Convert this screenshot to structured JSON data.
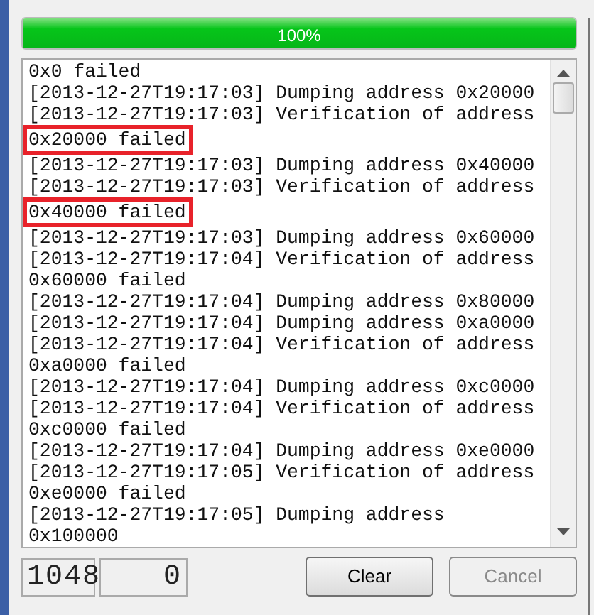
{
  "progress": {
    "level": 1,
    "label": "100%"
  },
  "log": [
    {
      "text": "0x0 failed",
      "highlighted": false
    },
    {
      "text": "[2013-12-27T19:17:03] Dumping address 0x20000",
      "highlighted": false
    },
    {
      "text": "[2013-12-27T19:17:03] Verification of address",
      "highlighted": false
    },
    {
      "text": "0x20000 failed",
      "highlighted": true
    },
    {
      "text": "[2013-12-27T19:17:03] Dumping address 0x40000",
      "highlighted": false
    },
    {
      "text": "[2013-12-27T19:17:03] Verification of address",
      "highlighted": false
    },
    {
      "text": "0x40000 failed",
      "highlighted": true
    },
    {
      "text": "[2013-12-27T19:17:03] Dumping address 0x60000",
      "highlighted": false
    },
    {
      "text": "[2013-12-27T19:17:04] Verification of address",
      "highlighted": false
    },
    {
      "text": "0x60000 failed",
      "highlighted": false
    },
    {
      "text": "[2013-12-27T19:17:04] Dumping address 0x80000",
      "highlighted": false
    },
    {
      "text": "[2013-12-27T19:17:04] Dumping address 0xa0000",
      "highlighted": false
    },
    {
      "text": "[2013-12-27T19:17:04] Verification of address",
      "highlighted": false
    },
    {
      "text": "0xa0000 failed",
      "highlighted": false
    },
    {
      "text": "[2013-12-27T19:17:04] Dumping address 0xc0000",
      "highlighted": false
    },
    {
      "text": "[2013-12-27T19:17:04] Verification of address",
      "highlighted": false
    },
    {
      "text": "0xc0000 failed",
      "highlighted": false
    },
    {
      "text": "[2013-12-27T19:17:04] Dumping address 0xe0000",
      "highlighted": false
    },
    {
      "text": "[2013-12-27T19:17:05] Verification of address",
      "highlighted": false
    },
    {
      "text": "0xe0000 failed",
      "highlighted": false
    },
    {
      "text": "[2013-12-27T19:17:05] Dumping address",
      "highlighted": false
    },
    {
      "text": "0x100000",
      "highlighted": false
    }
  ],
  "counters": [
    "1048",
    "0"
  ],
  "buttons": [
    {
      "label": "Clear",
      "disabled": false
    },
    {
      "label": "Cancel",
      "disabled": true
    }
  ]
}
